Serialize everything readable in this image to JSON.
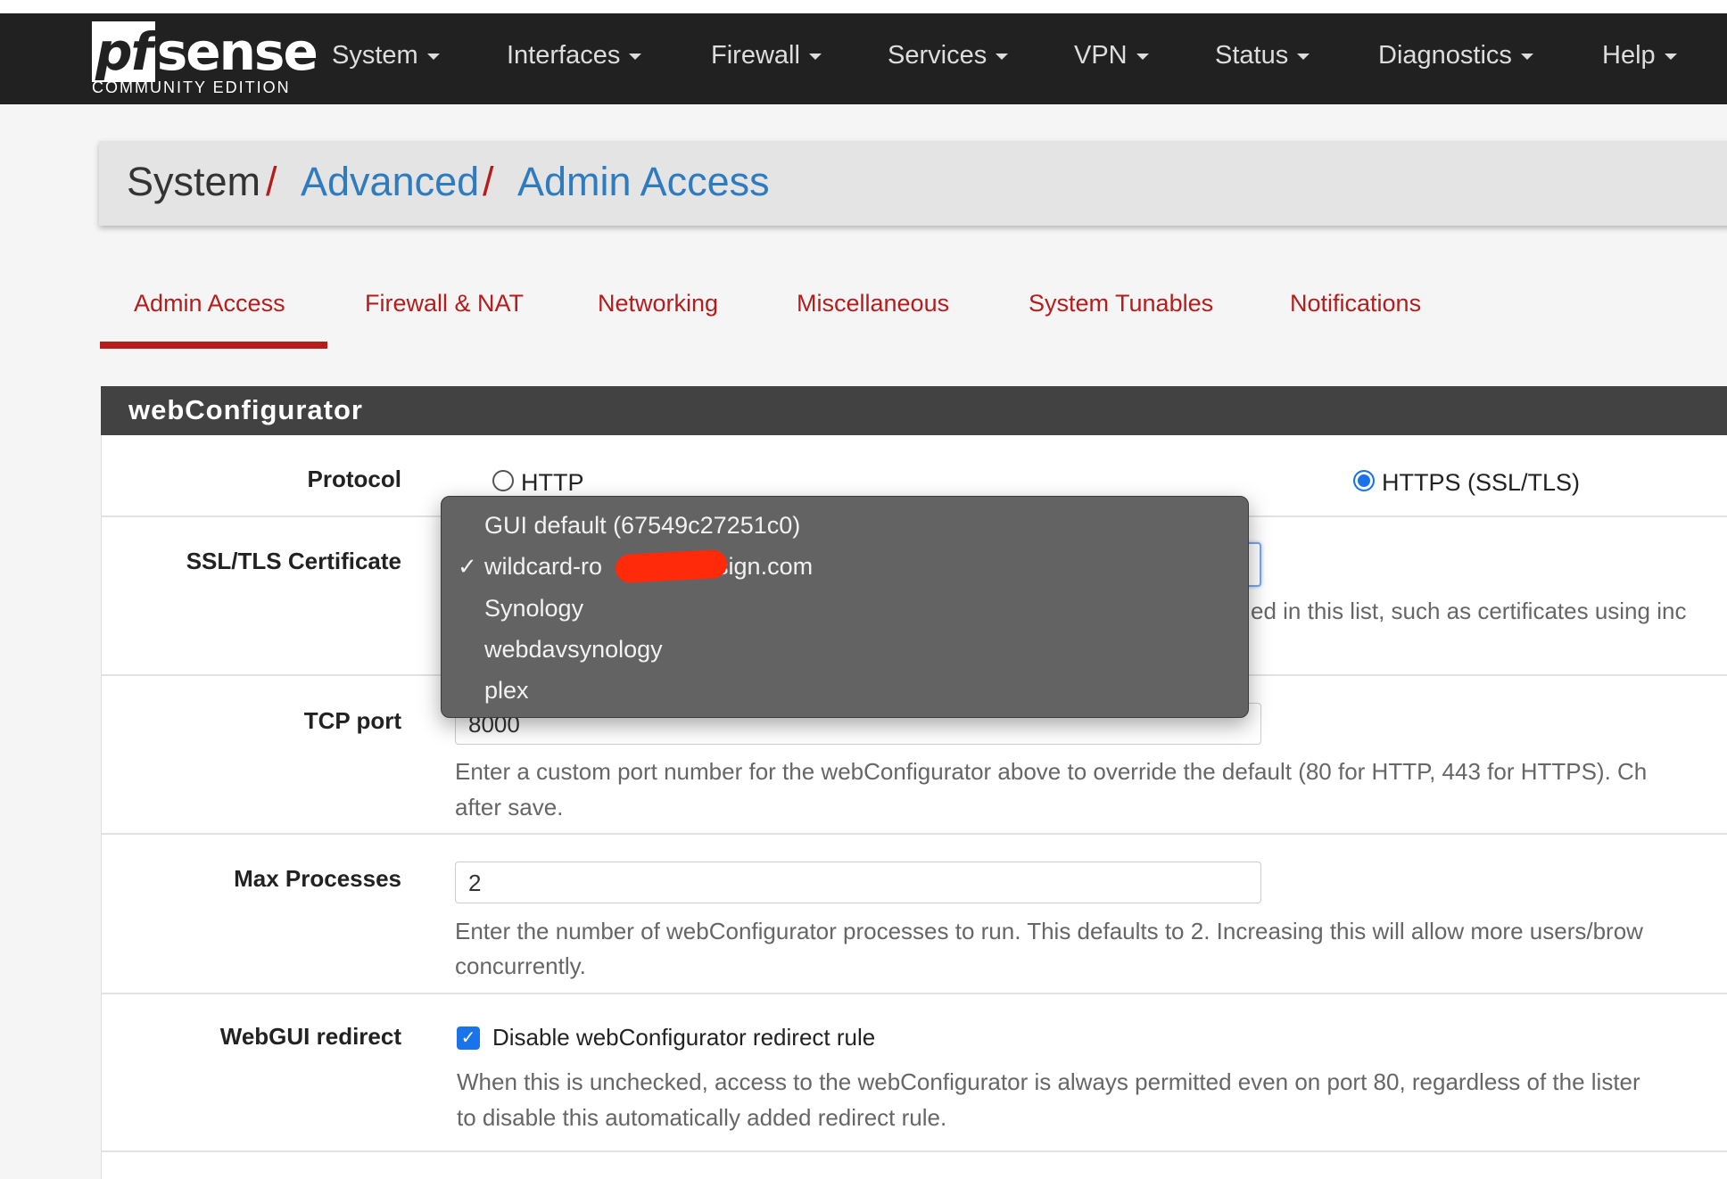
{
  "brand": {
    "logo_pf": "pf",
    "logo_sense": "sense",
    "edition": "COMMUNITY EDITION"
  },
  "nav": {
    "items": [
      "System",
      "Interfaces",
      "Firewall",
      "Services",
      "VPN",
      "Status",
      "Diagnostics",
      "Help"
    ]
  },
  "breadcrumb": {
    "root": "System",
    "sep": "/",
    "middle": "Advanced",
    "current": "Admin Access"
  },
  "tabs": {
    "active": "Admin Access",
    "items": [
      "Admin Access",
      "Firewall & NAT",
      "Networking",
      "Miscellaneous",
      "System Tunables",
      "Notifications"
    ]
  },
  "panel": {
    "title": "webConfigurator"
  },
  "protocol": {
    "label": "Protocol",
    "options": [
      "HTTP",
      "HTTPS (SSL/TLS)"
    ],
    "selected": "HTTPS (SSL/TLS)"
  },
  "ssl": {
    "label": "SSL/TLS Certificate",
    "help_visible": "ed in this list, such as certificates using inc",
    "dropdown": {
      "options": [
        "GUI default (67549c27251c0)",
        "wildcard-ro",
        "Synology",
        "webdavsynology",
        "plex"
      ],
      "selected_suffix": "sign.com",
      "check": "✓"
    }
  },
  "tcp": {
    "label": "TCP port",
    "value": "8000",
    "help1": "Enter a custom port number for the webConfigurator above to override the default (80 for HTTP, 443 for HTTPS). Ch",
    "help2": "after save."
  },
  "maxproc": {
    "label": "Max Processes",
    "value": "2",
    "help1": "Enter the number of webConfigurator processes to run. This defaults to 2. Increasing this will allow more users/brow",
    "help2": "concurrently."
  },
  "redirect": {
    "label": "WebGUI redirect",
    "checked": true,
    "checkbox_label": "Disable webConfigurator redirect rule",
    "help1": "When this is unchecked, access to the webConfigurator is always permitted even on port 80, regardless of the lister",
    "help2": "to disable this automatically added redirect rule."
  },
  "colors": {
    "navbar": "#212121",
    "accent_red": "#b71c1c",
    "link_blue": "#2f7bbf",
    "panel_header": "#424242",
    "checkbox_blue": "#1a73e8"
  }
}
